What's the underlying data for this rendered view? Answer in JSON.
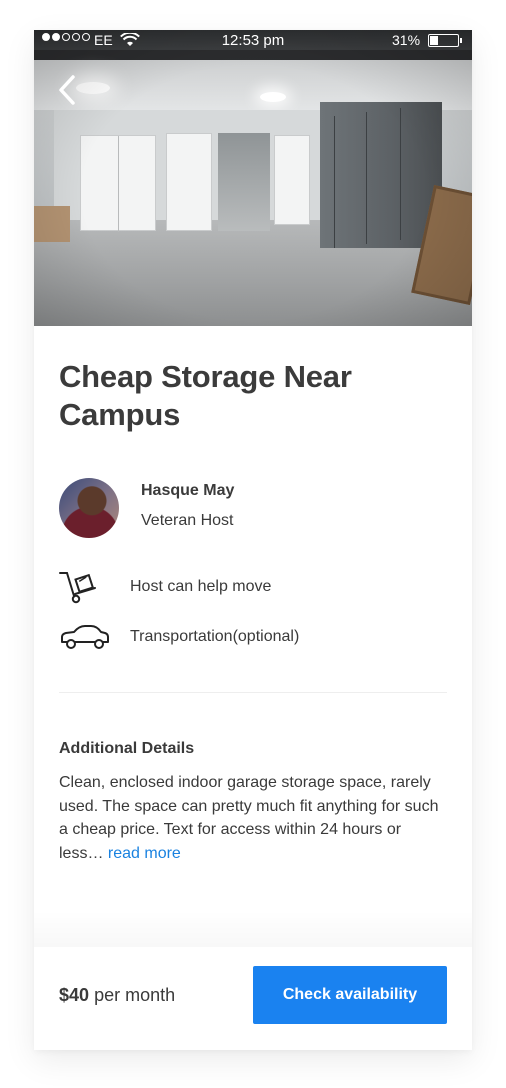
{
  "status_bar": {
    "carrier": "EE",
    "time": "12:53 pm",
    "battery_percent": "31%",
    "battery_level": 0.31,
    "signal_bars_filled": 2,
    "signal_bars_total": 5
  },
  "hero": {
    "back_icon": "chevron-left-icon"
  },
  "listing": {
    "title": "Cheap Storage Near Campus"
  },
  "host": {
    "name": "Hasque May",
    "role": "Veteran Host"
  },
  "features": [
    {
      "icon": "hand-truck-icon",
      "label": "Host can help move"
    },
    {
      "icon": "car-icon",
      "label": "Transportation(optional)"
    }
  ],
  "details": {
    "heading": "Additional Details",
    "body": "Clean, enclosed indoor garage storage space, rarely used. The space can pretty much fit anything for such a cheap price. Text for access within 24 hours or less…",
    "read_more": "read more"
  },
  "footer": {
    "price_amount": "$40",
    "price_period": "per month",
    "cta_label": "Check availability"
  },
  "colors": {
    "accent": "#1a82f0",
    "link": "#1a82e0",
    "text": "#3a3a3a"
  }
}
